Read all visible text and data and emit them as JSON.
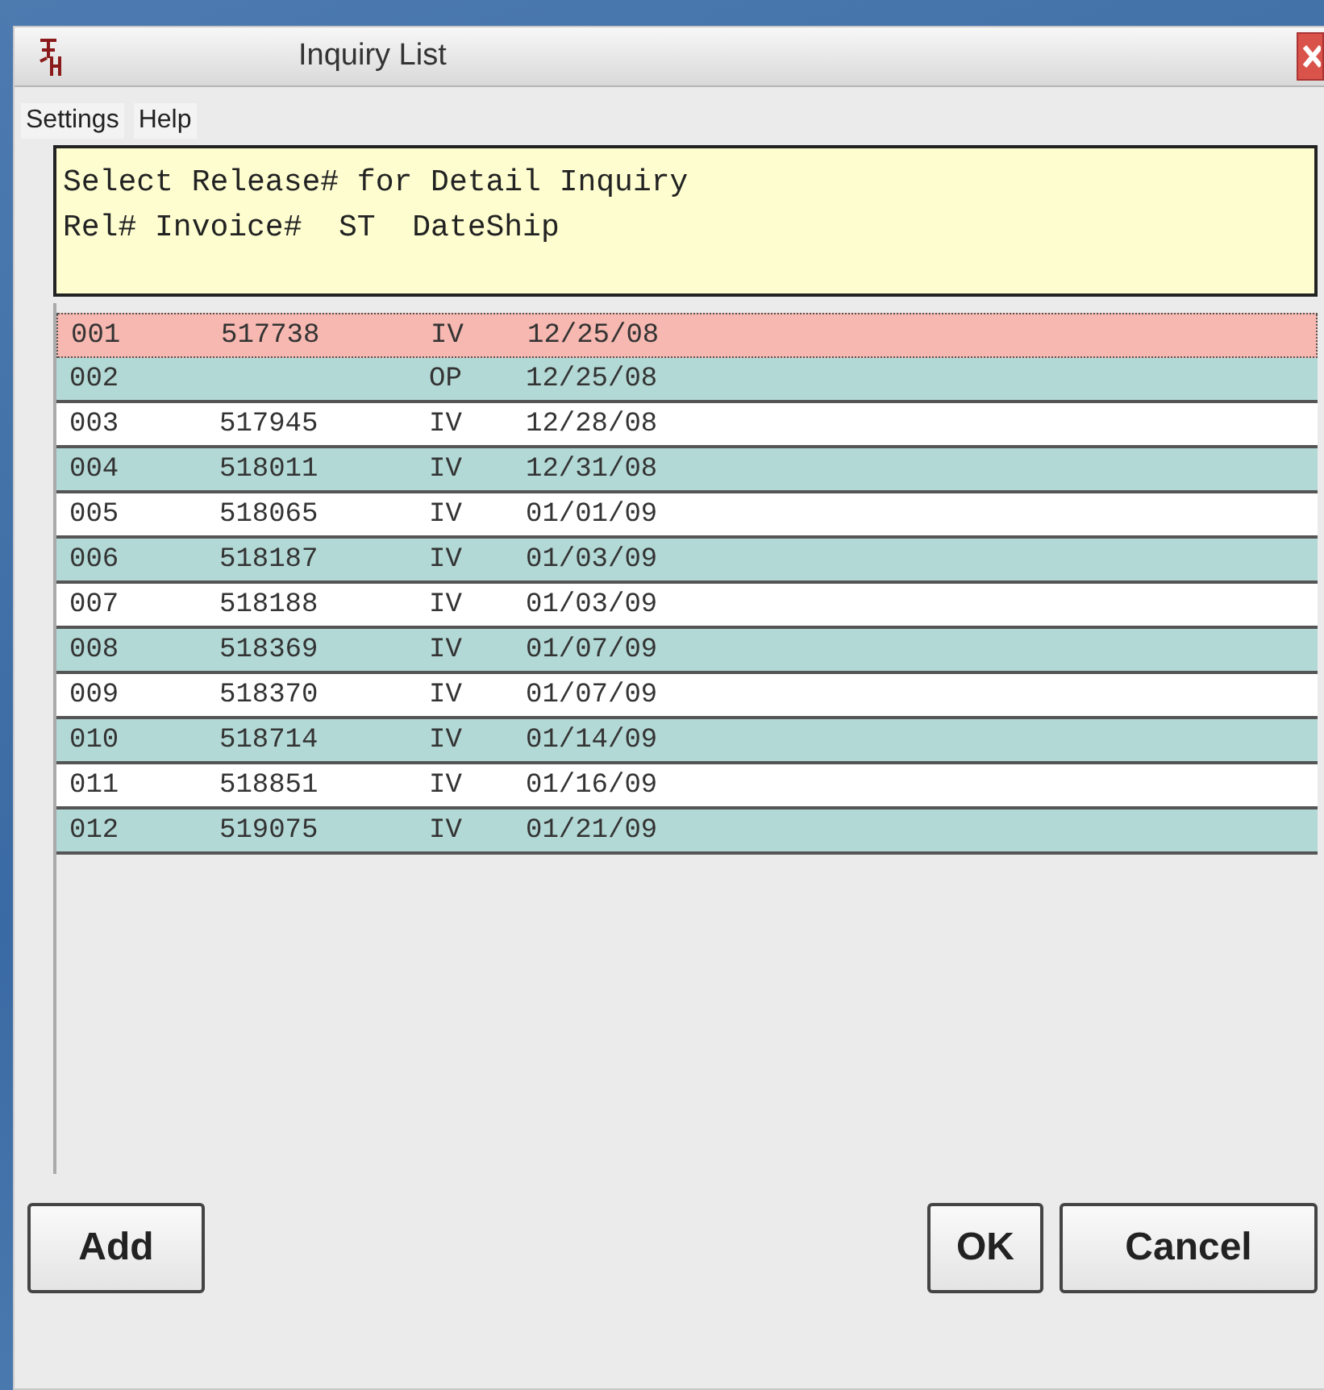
{
  "window": {
    "title": "Inquiry List"
  },
  "menu": [
    "Settings",
    "Help"
  ],
  "prompt": {
    "line_1": "Select Release# for Detail Inquiry",
    "line_2": "Rel# Invoice#  ST  DateShip"
  },
  "rows": [
    {
      "rel": "001",
      "invoice": "517738",
      "st": "IV",
      "date": "12/25/08",
      "selected": true
    },
    {
      "rel": "002",
      "invoice": "",
      "st": "OP",
      "date": "12/25/08",
      "selected": false
    },
    {
      "rel": "003",
      "invoice": "517945",
      "st": "IV",
      "date": "12/28/08",
      "selected": false
    },
    {
      "rel": "004",
      "invoice": "518011",
      "st": "IV",
      "date": "12/31/08",
      "selected": false
    },
    {
      "rel": "005",
      "invoice": "518065",
      "st": "IV",
      "date": "01/01/09",
      "selected": false
    },
    {
      "rel": "006",
      "invoice": "518187",
      "st": "IV",
      "date": "01/03/09",
      "selected": false
    },
    {
      "rel": "007",
      "invoice": "518188",
      "st": "IV",
      "date": "01/03/09",
      "selected": false
    },
    {
      "rel": "008",
      "invoice": "518369",
      "st": "IV",
      "date": "01/07/09",
      "selected": false
    },
    {
      "rel": "009",
      "invoice": "518370",
      "st": "IV",
      "date": "01/07/09",
      "selected": false
    },
    {
      "rel": "010",
      "invoice": "518714",
      "st": "IV",
      "date": "01/14/09",
      "selected": false
    },
    {
      "rel": "011",
      "invoice": "518851",
      "st": "IV",
      "date": "01/16/09",
      "selected": false
    },
    {
      "rel": "012",
      "invoice": "519075",
      "st": "IV",
      "date": "01/21/09",
      "selected": false
    }
  ],
  "buttons": {
    "add": "Add",
    "ok": "OK",
    "cancel": "Cancel"
  }
}
